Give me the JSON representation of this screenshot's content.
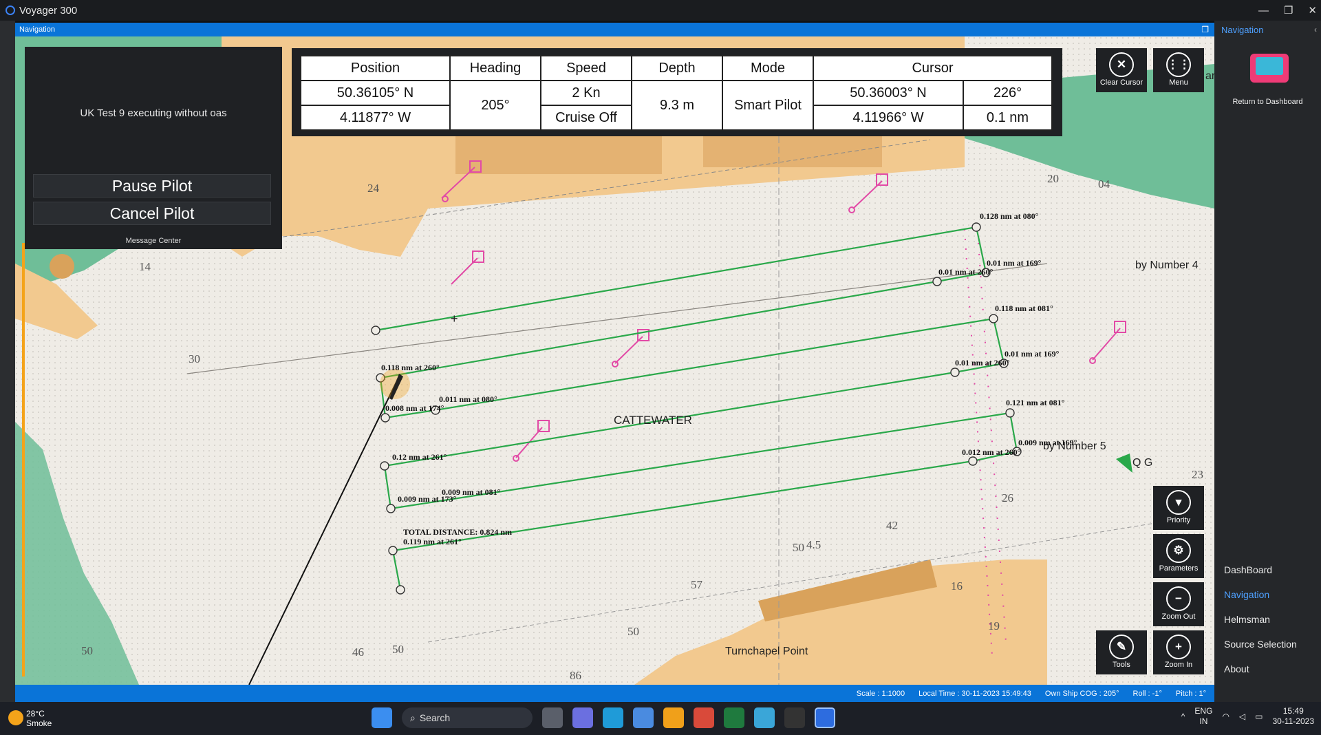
{
  "app": {
    "title": "Voyager 300"
  },
  "nav_bar": {
    "title": "Navigation"
  },
  "message_panel": {
    "message": "UK Test 9 executing without oas",
    "pause_label": "Pause Pilot",
    "cancel_label": "Cancel Pilot",
    "footer": "Message Center"
  },
  "nav_data": {
    "headers": {
      "position": "Position",
      "heading": "Heading",
      "speed": "Speed",
      "depth": "Depth",
      "mode": "Mode",
      "cursor": "Cursor"
    },
    "position_lat": "50.36105° N",
    "position_lon": "4.11877° W",
    "heading": "205°",
    "speed": "2 Kn",
    "cruise": "Cruise Off",
    "depth": "9.3 m",
    "mode": "Smart Pilot",
    "cursor_lat": "50.36003° N",
    "cursor_lon": "4.11966° W",
    "cursor_bearing": "226°",
    "cursor_range": "0.1 nm"
  },
  "tools": {
    "clear_cursor": "Clear Cursor",
    "menu": "Menu",
    "priority": "Priority",
    "parameters": "Parameters",
    "zoom_out": "Zoom Out",
    "zoom_in": "Zoom In",
    "tools": "Tools"
  },
  "chart_labels": {
    "cattewater": "CATTEWATER",
    "turnchapel": "Turnchapel Point",
    "number4": "by Number 4",
    "number5": "by Number 5",
    "qg": "Q G",
    "ar": "ar",
    "total_distance": "TOTAL DISTANCE: 0.824 nm",
    "legs": [
      "0.128 nm at 080°",
      "0.01 nm at 169°",
      "0.01 nm at 260°",
      "0.118 nm at 081°",
      "0.01 nm at 169°",
      "0.01 nm at 260°",
      "0.118 nm at 260°",
      "0.011 nm at 080°",
      "0.008 nm at 174°",
      "0.121 nm at 081°",
      "0.009 nm at 169°",
      "0.012 nm at 260°",
      "0.12 nm at 261°",
      "0.009 nm at 081°",
      "0.009 nm at 173°",
      "0.119 nm at 261°"
    ],
    "soundings": [
      "24",
      "14",
      "30",
      "20",
      "04",
      "57",
      "16",
      "19",
      "50",
      "50",
      "46",
      "50",
      "42",
      "23",
      "26",
      "4.5",
      "50",
      "86"
    ]
  },
  "right_panel": {
    "title": "Navigation",
    "return": "Return to Dashboard",
    "items": [
      "DashBoard",
      "Navigation",
      "Helmsman",
      "Source Selection",
      "About"
    ]
  },
  "status_bar": {
    "scale": "Scale : 1:1000",
    "local_time": "Local Time : 30-11-2023 15:49:43",
    "cog": "Own Ship COG : 205°",
    "roll": "Roll : -1°",
    "pitch": "Pitch : 1°"
  },
  "taskbar": {
    "temp": "28°C",
    "weather": "Smoke",
    "search": "Search",
    "lang1": "ENG",
    "lang2": "IN",
    "time": "15:49",
    "date": "30-11-2023"
  },
  "colors": {
    "land": "#f2c98f",
    "shallow": "#6fbe98",
    "route": "#2aa84a",
    "accent": "#0a74d8",
    "magenta": "#e24aa6"
  }
}
